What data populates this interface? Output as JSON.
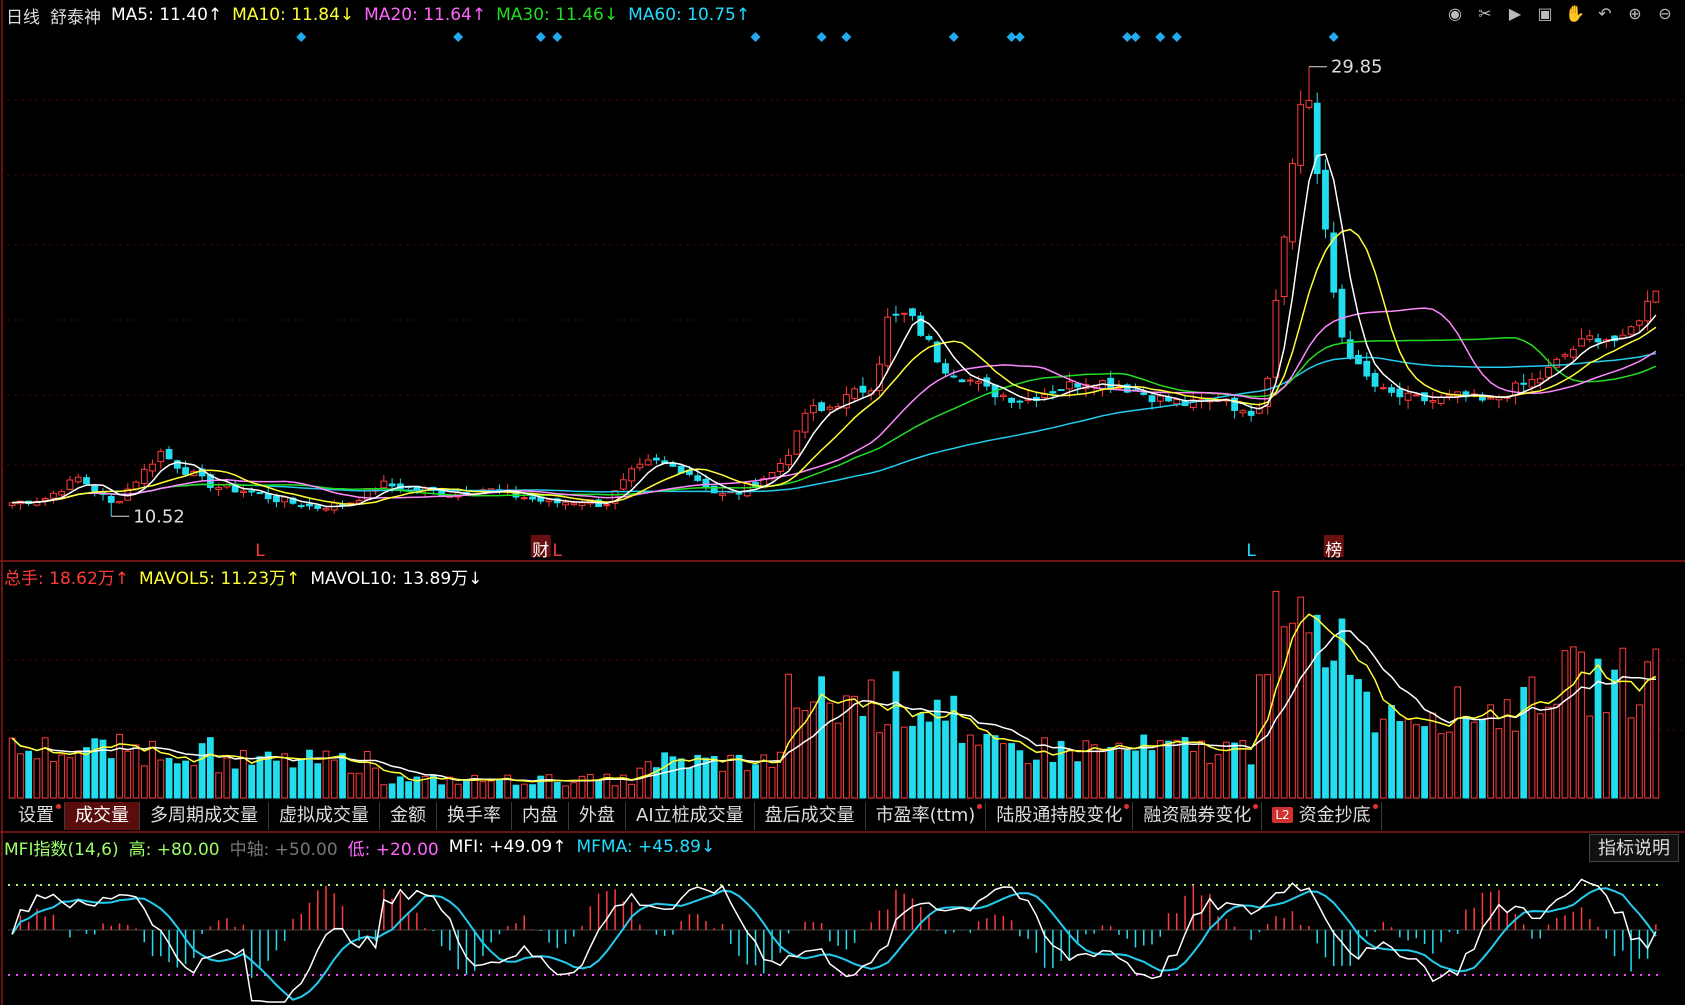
{
  "header": {
    "period": "日线",
    "stock_name": "舒泰神",
    "ma5": "MA5: 11.40↑",
    "ma10": "MA10: 11.84↓",
    "ma20": "MA20: 11.64↑",
    "ma30": "MA30: 11.46↓",
    "ma60": "MA60: 10.75↑"
  },
  "toolbar_icons": [
    "eye-icon",
    "scissors-icon",
    "play-icon",
    "lock-icon",
    "hand-icon",
    "undo-icon",
    "zoom-in-icon",
    "zoom-out-icon"
  ],
  "volume_header": {
    "total": "总手: 18.62万↑",
    "mavol5": "MAVOL5: 11.23万↑",
    "mavol10": "MAVOL10: 13.89万↓"
  },
  "tabs": [
    {
      "label": "设置",
      "dot": true
    },
    {
      "label": "成交量",
      "active": true
    },
    {
      "label": "多周期成交量"
    },
    {
      "label": "虚拟成交量"
    },
    {
      "label": "金额"
    },
    {
      "label": "换手率"
    },
    {
      "label": "内盘"
    },
    {
      "label": "外盘"
    },
    {
      "label": "AI立桩成交量"
    },
    {
      "label": "盘后成交量"
    },
    {
      "label": "市盈率(ttm)",
      "dot": true
    },
    {
      "label": "陆股通持股变化",
      "dot": true
    },
    {
      "label": "融资融券变化",
      "dot": true
    },
    {
      "label": "资金抄底",
      "badge": "L2",
      "dot": true
    }
  ],
  "mfi_header": {
    "name": "MFI指数(14,6)",
    "high": "高: +80.00",
    "mid": "中轴: +50.00",
    "low": "低: +20.00",
    "mfi": "MFI: +49.09↑",
    "mfma": "MFMA: +45.89↓"
  },
  "explain_button": "指标说明",
  "colors": {
    "up": "#ff3b3b",
    "down": "#22ddee",
    "ma5": "#ffffff",
    "ma10": "#ffff33",
    "ma20": "#ff88ff",
    "ma30": "#22dd22",
    "ma60": "#22ccee"
  },
  "chart_data": {
    "type": "candlestick",
    "price_annotations": {
      "high": "29.85",
      "low": "10.52"
    },
    "markers": [
      {
        "text": "L",
        "index": 37
      },
      {
        "text": "财",
        "index": 78
      },
      {
        "text": "L",
        "index": 80
      },
      {
        "text": "L",
        "index": 183
      },
      {
        "text": "榜",
        "index": 195
      }
    ],
    "diamond_indices": [
      43,
      66,
      79,
      81,
      110,
      120,
      124,
      140,
      148,
      150,
      165,
      167,
      171,
      173,
      196
    ],
    "candles": [],
    "volume": [],
    "ma5": [],
    "ma10": [],
    "ma20": [],
    "ma30": [],
    "ma60": [],
    "mavol5": [],
    "mavol10": [],
    "mfi": [],
    "mfma": [],
    "price_range": [
      9.5,
      31
    ],
    "volume_max": 26,
    "mfi_range": [
      0,
      100
    ],
    "mfi_levels": {
      "high": 80,
      "mid": 50,
      "low": 20
    }
  }
}
